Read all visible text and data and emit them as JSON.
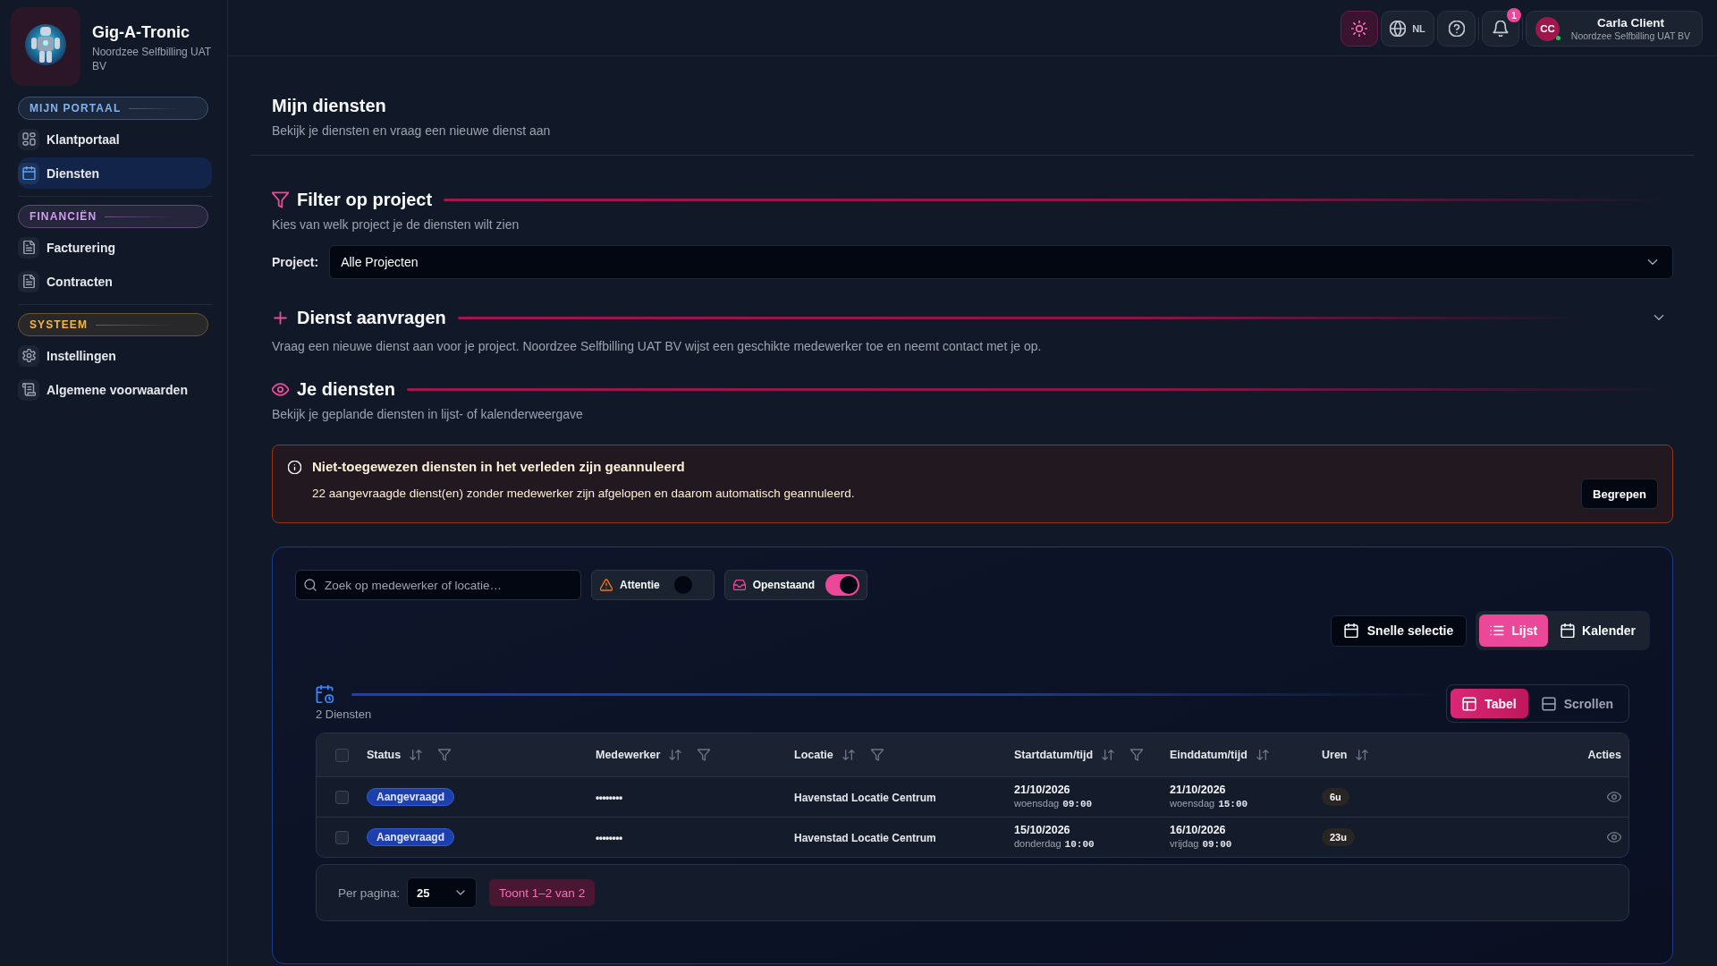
{
  "sidebar": {
    "brand": {
      "title": "Gig-A-Tronic",
      "subtitle": "Noordzee Selfbilling UAT BV"
    },
    "sections": [
      {
        "label": "MIJN PORTAAL",
        "color": "#7fb2f0",
        "items": [
          {
            "label": "Klantportaal",
            "selected": false
          },
          {
            "label": "Diensten",
            "selected": true
          }
        ]
      },
      {
        "label": "FINANCIËN",
        "color": "#d59cf0",
        "items": [
          {
            "label": "Facturering",
            "selected": false
          },
          {
            "label": "Contracten",
            "selected": false
          }
        ]
      },
      {
        "label": "SYSTEEM",
        "color": "#f4b740",
        "items": [
          {
            "label": "Instellingen",
            "selected": false
          },
          {
            "label": "Algemene voorwaarden",
            "selected": false
          }
        ]
      }
    ]
  },
  "topbar": {
    "language": "NL",
    "notifications": {
      "badge": "1"
    },
    "user": {
      "initials": "CC",
      "name": "Carla Client",
      "company": "Noordzee Selfbilling UAT BV",
      "online": true
    }
  },
  "page": {
    "title": "Mijn diensten",
    "subtitle": "Bekijk je diensten en vraag een nieuwe dienst aan"
  },
  "sections": [
    {
      "kind": "filter",
      "title": "Filter op project",
      "description": "Kies van welk project je de diensten wilt zien",
      "field": {
        "label": "Project:",
        "value": "Alle Projecten"
      }
    },
    {
      "kind": "request",
      "title": "Dienst aanvragen",
      "description": "Vraag een nieuwe dienst aan voor je project. Noordzee Selfbilling UAT BV wijst een geschikte medewerker toe en neemt contact met je op.",
      "expanded": false
    },
    {
      "kind": "services",
      "title": "Je diensten",
      "description": "Bekijk je geplande diensten in lijst- of kalenderweergave"
    }
  ],
  "alert": {
    "title": "Niet-toegewezen diensten in het verleden zijn geannuleerd",
    "message": "22 aangevraagde dienst(en) zonder medewerker zijn afgelopen en daarom automatisch geannuleerd.",
    "button": "Begrepen"
  },
  "services": {
    "search": {
      "placeholder": "Zoek op medewerker of locatie…"
    },
    "toggles": [
      {
        "label": "Attentie",
        "on": false
      },
      {
        "label": "Openstaand",
        "on": true
      }
    ],
    "quick_select": "Snelle selectie",
    "views": [
      {
        "label": "Lijst",
        "selected": true
      },
      {
        "label": "Kalender",
        "selected": false
      }
    ],
    "count": "2 Diensten",
    "layouts": [
      {
        "label": "Tabel",
        "selected": true
      },
      {
        "label": "Scrollen",
        "selected": false
      }
    ],
    "table": {
      "select_all": {
        "checked": false
      },
      "columns": [
        {
          "label": "Status",
          "sortable": true,
          "filterable": true
        },
        {
          "label": "Medewerker",
          "sortable": true,
          "filterable": true
        },
        {
          "label": "Locatie",
          "sortable": true,
          "filterable": true
        },
        {
          "label": "Startdatum/tijd",
          "sortable": true,
          "filterable": true
        },
        {
          "label": "Einddatum/tijd",
          "sortable": true,
          "filterable": false
        },
        {
          "label": "Uren",
          "sortable": true,
          "filterable": false
        },
        {
          "label": "Acties",
          "sortable": false,
          "filterable": false
        }
      ],
      "rows": [
        {
          "checked": false,
          "status": "Aangevraagd",
          "employee": "••••••••",
          "location": "Havenstad Locatie Centrum",
          "start": {
            "date": "21/10/2026",
            "day": "woensdag",
            "time": "09:00"
          },
          "end": {
            "date": "21/10/2026",
            "day": "woensdag",
            "time": "15:00"
          },
          "hours": "6u"
        },
        {
          "checked": false,
          "status": "Aangevraagd",
          "employee": "••••••••",
          "location": "Havenstad Locatie Centrum",
          "start": {
            "date": "15/10/2026",
            "day": "donderdag",
            "time": "10:00"
          },
          "end": {
            "date": "16/10/2026",
            "day": "vrijdag",
            "time": "09:00"
          },
          "hours": "23u"
        }
      ]
    },
    "pagination": {
      "label": "Per pagina:",
      "page_size": "25",
      "summary": "Toont 1–2 van 2"
    }
  }
}
